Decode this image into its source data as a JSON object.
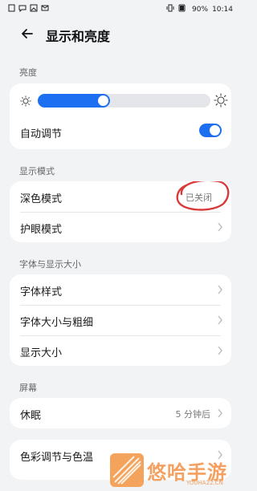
{
  "status": {
    "battery": "90%",
    "time": "10:14"
  },
  "header": {
    "title": "显示和亮度"
  },
  "brightness": {
    "section_label": "亮度",
    "level_percent": 42,
    "auto_label": "自动调节",
    "auto_on": true
  },
  "display_mode": {
    "section_label": "显示模式",
    "dark_mode_label": "深色模式",
    "dark_mode_value": "已关闭",
    "eye_comfort_label": "护眼模式"
  },
  "font_display": {
    "section_label": "字体与显示大小",
    "font_style_label": "字体样式",
    "font_size_label": "字体大小与粗细",
    "display_size_label": "显示大小"
  },
  "screen": {
    "section_label": "屏幕",
    "sleep_label": "休眠",
    "sleep_value": "5 分钟后"
  },
  "color": {
    "color_temp_label": "色彩调节与色温"
  },
  "watermark": {
    "text": "悠哈手游",
    "url": "YOUHA22.CN"
  },
  "colors": {
    "accent": "#1d6ff2",
    "annotation": "#d83a3a",
    "watermark": "#f3a060"
  }
}
